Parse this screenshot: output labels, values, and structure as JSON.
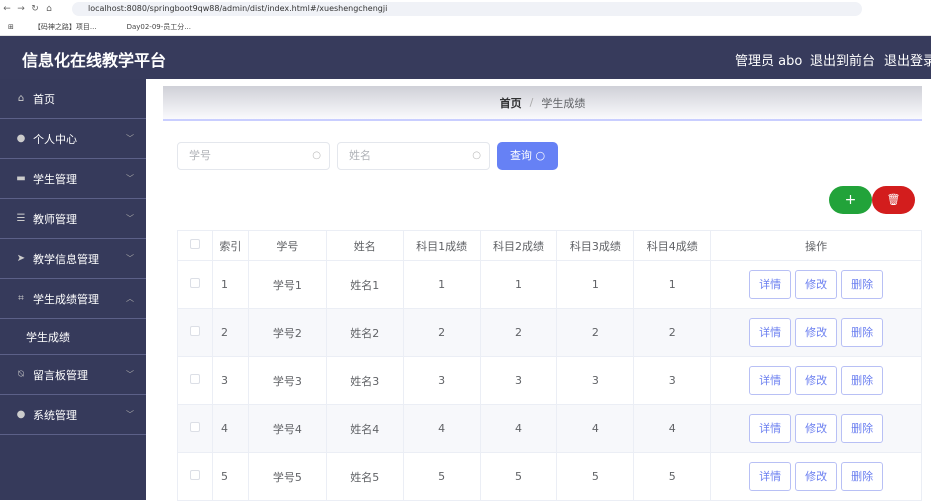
{
  "browser": {
    "url": "localhost:8080/springboot9qw88/admin/dist/index.html#/xueshengchengji",
    "bookmarks": [
      "【码神之路】项目...",
      "Day02-09-员工分..."
    ]
  },
  "header": {
    "title": "信息化在线教学平台",
    "user": "管理员 abo",
    "front": "退出到前台",
    "logout": "退出登录"
  },
  "sidebar": {
    "items": [
      {
        "label": "首页",
        "icon": "home-icon",
        "glyph": "⌂"
      },
      {
        "label": "个人中心",
        "icon": "user-icon",
        "glyph": "●"
      },
      {
        "label": "学生管理",
        "icon": "briefcase-icon",
        "glyph": "▬"
      },
      {
        "label": "教师管理",
        "icon": "list-icon",
        "glyph": "☰"
      },
      {
        "label": "教学信息管理",
        "icon": "send-icon",
        "glyph": "➤"
      },
      {
        "label": "学生成绩管理",
        "icon": "crop-icon",
        "glyph": "⌗"
      },
      {
        "label": "留言板管理",
        "icon": "bell-off-icon",
        "glyph": "⍉"
      },
      {
        "label": "系统管理",
        "icon": "globe-icon",
        "glyph": "●"
      }
    ],
    "subitem": "学生成绩"
  },
  "breadcrumb": {
    "home": "首页",
    "current": "学生成绩"
  },
  "search": {
    "student_no_placeholder": "学号",
    "name_placeholder": "姓名",
    "query_label": "查询"
  },
  "colors": {
    "header": "#373b5c",
    "sidebar": "#363a5b",
    "primary": "#6681f5",
    "add": "#22a33a",
    "delete": "#d31d1d"
  },
  "table": {
    "headers": [
      "索引",
      "学号",
      "姓名",
      "科目1成绩",
      "科目2成绩",
      "科目3成绩",
      "科目4成绩",
      "操作"
    ],
    "rows": [
      [
        "1",
        "学号1",
        "姓名1",
        "1",
        "1",
        "1",
        "1"
      ],
      [
        "2",
        "学号2",
        "姓名2",
        "2",
        "2",
        "2",
        "2"
      ],
      [
        "3",
        "学号3",
        "姓名3",
        "3",
        "3",
        "3",
        "3"
      ],
      [
        "4",
        "学号4",
        "姓名4",
        "4",
        "4",
        "4",
        "4"
      ],
      [
        "5",
        "学号5",
        "姓名5",
        "5",
        "5",
        "5",
        "5"
      ]
    ],
    "actions": [
      "详情",
      "修改",
      "删除"
    ]
  }
}
